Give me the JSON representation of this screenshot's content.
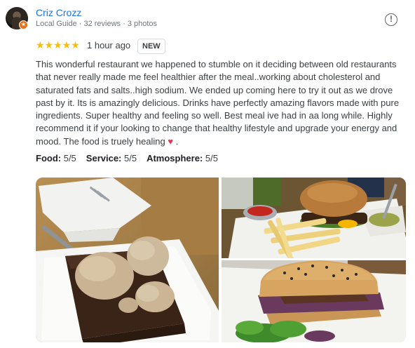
{
  "review": {
    "author_name": "Criz Crozz",
    "author_meta": "Local Guide · 32 reviews · 3 photos",
    "rating_stars": "★★★★★",
    "rating_value": 5,
    "time_ago": "1 hour ago",
    "new_badge": "NEW",
    "report_icon": "!",
    "text": "This wonderful restaurant we happened to stumble on it deciding between old restaurants that never really made me feel healthier after the meal..working about cholesterol and saturated fats and salts..high sodium. We ended up coming here to try it out as we drove past by it. Its is amazingly delicious. Drinks have perfectly amazing flavors made with pure ingredients. Super healthy and feeling so well. Best meal ive had in aa long while. Highly recommend it if your looking to change that healthy lifestyle and upgrade your energy and mood. The food is truely healing",
    "text_end_emoji": "♥",
    "text_end_punct": ".",
    "attributes": [
      {
        "label": "Food:",
        "value": "5/5"
      },
      {
        "label": "Service:",
        "value": "5/5"
      },
      {
        "label": "Atmosphere:",
        "value": "5/5"
      }
    ]
  },
  "colors": {
    "author_link": "#1a73e8",
    "star": "#fbbc04",
    "badge_orange": "#e8711c",
    "heart": "#e8345a"
  },
  "icons": {
    "avatar": "avatar-photo",
    "local_guide": "local-guide-badge-icon",
    "report": "report-icon"
  },
  "photos": [
    {
      "name": "brownie-with-ice-cream-photo"
    },
    {
      "name": "burger-and-fries-photo"
    },
    {
      "name": "sandwich-with-salad-photo"
    }
  ]
}
